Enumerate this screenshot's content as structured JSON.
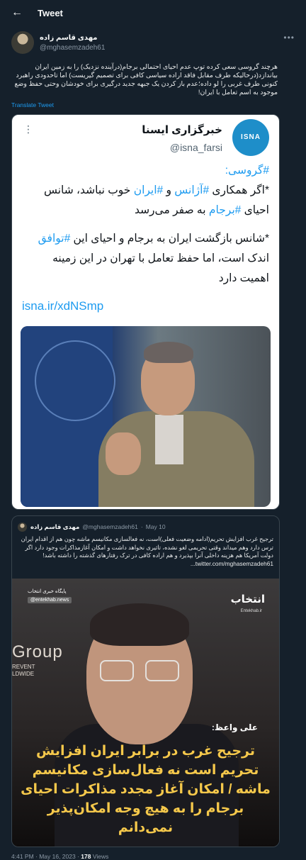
{
  "header": {
    "title": "Tweet",
    "back_icon": "arrow-left-icon"
  },
  "author": {
    "name": "مهدی قاسم زاده",
    "handle": "@mghasemzadeh61"
  },
  "tweet": {
    "text": "هرچند گروسی سعی کرده توپ عدم احیای احتمالی برجام(درآینده نزدیک) را به زمین ایران بیاندازد(درحالیکه طرف مقابل فاقد اراده سیاسی کافی برای تصمیم گیریست) اما تاحدودی راهبرد کنونی طرف غربی را لو داده؛عدم باز کردن یک جبهه جدید درگیری برای خودشان وحتی حفظ وضع موجود به اسم تعامل با ایران!",
    "translate_label": "Translate Tweet"
  },
  "media1": {
    "source_name": "خبرگزاری ایسنا",
    "source_handle": "@isna_farsi",
    "logo_text": "ISNA",
    "para1_tag": "#گروسی:",
    "para1_line_a": "*اگر همکاری ",
    "para1_tag_a": "#آژانس",
    "para1_mid": " و ",
    "para1_tag_b": "#ایران",
    "para1_end": " خوب نباشد، شانس احیای ",
    "para1_tag_c": "#برجام",
    "para1_tail": " به صفر می‌رسد",
    "para2_a": "*شانس بازگشت ایران به برجام و احیای این ",
    "para2_tag": "#توافق",
    "para2_b": " اندک است، اما حفظ تعامل با تهران در این زمینه اهمیت دارد",
    "link": "isna.ir/xdNSmp"
  },
  "quote": {
    "name": "مهدی قاسم زاده",
    "handle": "@mghasemzadeh61",
    "date": "May 10",
    "text": "ترجیح غرب افزایش تحریم(ادامه وضعیت فعلی)است، نه فعالسازی مکانیسم ماشه چون هم از اقدام ایران ترس دارد وهم میداند وقتی تحریمی لغو نشده، تاثیری نخواهد داشت و امکان آغازمذاکرات وجود دارد اگر دولت آمریکا هم هزینه داخلی آنرا بپذیرد و هم اراده کافی در ترک رفتارهای گذشته را داشته باشد! twitter.com/mghasemzadeh61...",
    "image_source_name": "پایگاه خبری انتخاب",
    "image_source_handle": "@entekhab.news",
    "image_logo": "انتخاب",
    "image_logo_sub": "Entekhab.ir",
    "image_bg_word": "Group",
    "image_bg_sub": "REVENT\nLDWIDE",
    "speaker_label": "علی واعظ:",
    "headline": "ترجیح غرب در برابر ایران افزایش تحریم است نه فعال‌سازی مکانیسم ماشه / امکان آغاز مجدد مذاکرات احیای برجام را به هیچ وجه امکان‌پذیر نمی‌دانم"
  },
  "footer": {
    "time": "4:41 PM · May 16, 2023 · ",
    "views_count": "178",
    "views_label": " Views"
  }
}
